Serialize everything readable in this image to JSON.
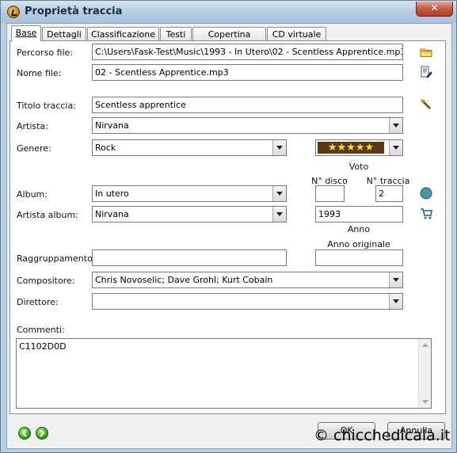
{
  "window": {
    "title": "Proprietà traccia",
    "close_glyph": "✕"
  },
  "tabs": [
    {
      "label": "Base"
    },
    {
      "label": "Dettagli"
    },
    {
      "label": "Classificazione"
    },
    {
      "label": "Testi"
    },
    {
      "label": "Copertina album"
    },
    {
      "label": "CD virtuale"
    }
  ],
  "form": {
    "file_path": {
      "label": "Percorso file:",
      "value": "C:\\Users\\Fask-Test\\Music\\1993 - In Utero\\02 - Scentless Apprentice.mp3"
    },
    "file_name": {
      "label": "Nome file:",
      "value": "02 - Scentless Apprentice.mp3"
    },
    "track_title": {
      "label": "Titolo traccia:",
      "value": "Scentless apprentice"
    },
    "artist": {
      "label": "Artista:",
      "value": "Nirvana"
    },
    "genre": {
      "label": "Genere:",
      "value": "Rock"
    },
    "rating": {
      "label": "Voto",
      "stars": 5,
      "max": 5,
      "display": "★★★★★"
    },
    "disc_no": {
      "label": "N° disco",
      "value": ""
    },
    "track_no": {
      "label": "N° traccia",
      "value": "2"
    },
    "album": {
      "label": "Album:",
      "value": "In utero"
    },
    "album_artist": {
      "label": "Artista album:",
      "value": "Nirvana"
    },
    "year": {
      "label": "Anno",
      "value": "1993"
    },
    "original_year": {
      "label": "Anno originale",
      "value": ""
    },
    "grouping": {
      "label": "Raggruppamento:",
      "value": ""
    },
    "composer": {
      "label": "Compositore:",
      "value": "Chris Novoselic; Dave Grohl; Kurt Cobain"
    },
    "conductor": {
      "label": "Direttore:",
      "value": ""
    },
    "comments": {
      "label": "Commenti:",
      "value": "C1102D0D"
    }
  },
  "buttons": {
    "ok": "OK",
    "cancel": "Annulla"
  },
  "watermark": "© chicchedicala.it",
  "icons": {
    "browse": "folder-icon",
    "rename": "rename-icon",
    "auto_tag": "magic-wand-icon",
    "web_lookup": "globe-icon",
    "shop": "shopping-cart-icon",
    "prev": "previous-arrow-icon",
    "next": "next-arrow-icon"
  },
  "colors": {
    "star": "#ffd83a",
    "title_bar": "#b3cbe2",
    "close_button": "#c45a43"
  }
}
